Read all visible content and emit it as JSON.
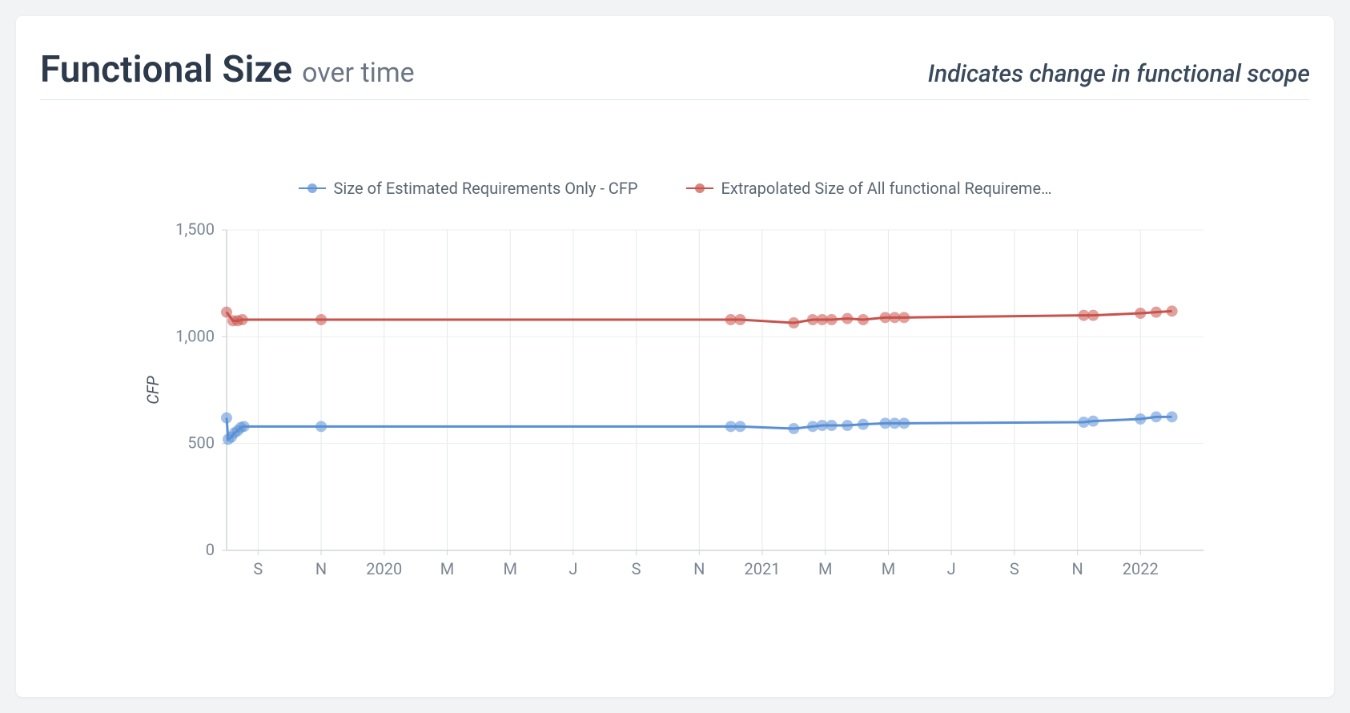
{
  "header": {
    "title_main": "Functional Size",
    "title_sub": "over time",
    "subtitle_right": "Indicates change in functional scope"
  },
  "chart_data": {
    "type": "line",
    "ylabel": "CFP",
    "ylim": [
      0,
      1500
    ],
    "yticks": [
      0,
      500,
      1000,
      1500
    ],
    "x_range": [
      0,
      31
    ],
    "x_ticks": [
      {
        "t": 1,
        "label": "S"
      },
      {
        "t": 3,
        "label": "N"
      },
      {
        "t": 5,
        "label": "2020"
      },
      {
        "t": 7,
        "label": "M"
      },
      {
        "t": 9,
        "label": "M"
      },
      {
        "t": 11,
        "label": "J"
      },
      {
        "t": 13,
        "label": "S"
      },
      {
        "t": 15,
        "label": "N"
      },
      {
        "t": 17,
        "label": "2021"
      },
      {
        "t": 19,
        "label": "M"
      },
      {
        "t": 21,
        "label": "M"
      },
      {
        "t": 23,
        "label": "J"
      },
      {
        "t": 25,
        "label": "S"
      },
      {
        "t": 27,
        "label": "N"
      },
      {
        "t": 29,
        "label": "2022"
      }
    ],
    "legend": [
      {
        "name": "Size of Estimated Requirements Only - CFP",
        "color": "#5a8fd6"
      },
      {
        "name": "Extrapolated Size of All functional Requireme…",
        "color": "#c9524b"
      }
    ],
    "series": [
      {
        "name": "Size of Estimated Requirements Only - CFP",
        "color": "#5a8fd6",
        "points": [
          {
            "t": 0.0,
            "y": 620
          },
          {
            "t": 0.05,
            "y": 520
          },
          {
            "t": 0.15,
            "y": 530
          },
          {
            "t": 0.25,
            "y": 550
          },
          {
            "t": 0.35,
            "y": 560
          },
          {
            "t": 0.45,
            "y": 575
          },
          {
            "t": 0.55,
            "y": 580
          },
          {
            "t": 3.0,
            "y": 580
          },
          {
            "t": 16.0,
            "y": 580
          },
          {
            "t": 16.3,
            "y": 580
          },
          {
            "t": 18.0,
            "y": 570
          },
          {
            "t": 18.6,
            "y": 580
          },
          {
            "t": 18.9,
            "y": 585
          },
          {
            "t": 19.2,
            "y": 585
          },
          {
            "t": 19.7,
            "y": 585
          },
          {
            "t": 20.2,
            "y": 590
          },
          {
            "t": 20.9,
            "y": 595
          },
          {
            "t": 21.2,
            "y": 595
          },
          {
            "t": 21.5,
            "y": 595
          },
          {
            "t": 27.2,
            "y": 600
          },
          {
            "t": 27.5,
            "y": 605
          },
          {
            "t": 29.0,
            "y": 615
          },
          {
            "t": 29.5,
            "y": 625
          },
          {
            "t": 30.0,
            "y": 625
          }
        ]
      },
      {
        "name": "Extrapolated Size of All functional Requirements",
        "color": "#c9524b",
        "points": [
          {
            "t": 0.0,
            "y": 1115
          },
          {
            "t": 0.2,
            "y": 1075
          },
          {
            "t": 0.35,
            "y": 1075
          },
          {
            "t": 0.5,
            "y": 1080
          },
          {
            "t": 3.0,
            "y": 1080
          },
          {
            "t": 16.0,
            "y": 1080
          },
          {
            "t": 16.3,
            "y": 1080
          },
          {
            "t": 18.0,
            "y": 1065
          },
          {
            "t": 18.6,
            "y": 1080
          },
          {
            "t": 18.9,
            "y": 1080
          },
          {
            "t": 19.2,
            "y": 1080
          },
          {
            "t": 19.7,
            "y": 1085
          },
          {
            "t": 20.2,
            "y": 1080
          },
          {
            "t": 20.9,
            "y": 1090
          },
          {
            "t": 21.2,
            "y": 1090
          },
          {
            "t": 21.5,
            "y": 1090
          },
          {
            "t": 27.2,
            "y": 1100
          },
          {
            "t": 27.5,
            "y": 1100
          },
          {
            "t": 29.0,
            "y": 1110
          },
          {
            "t": 29.5,
            "y": 1115
          },
          {
            "t": 30.0,
            "y": 1120
          }
        ]
      }
    ]
  }
}
